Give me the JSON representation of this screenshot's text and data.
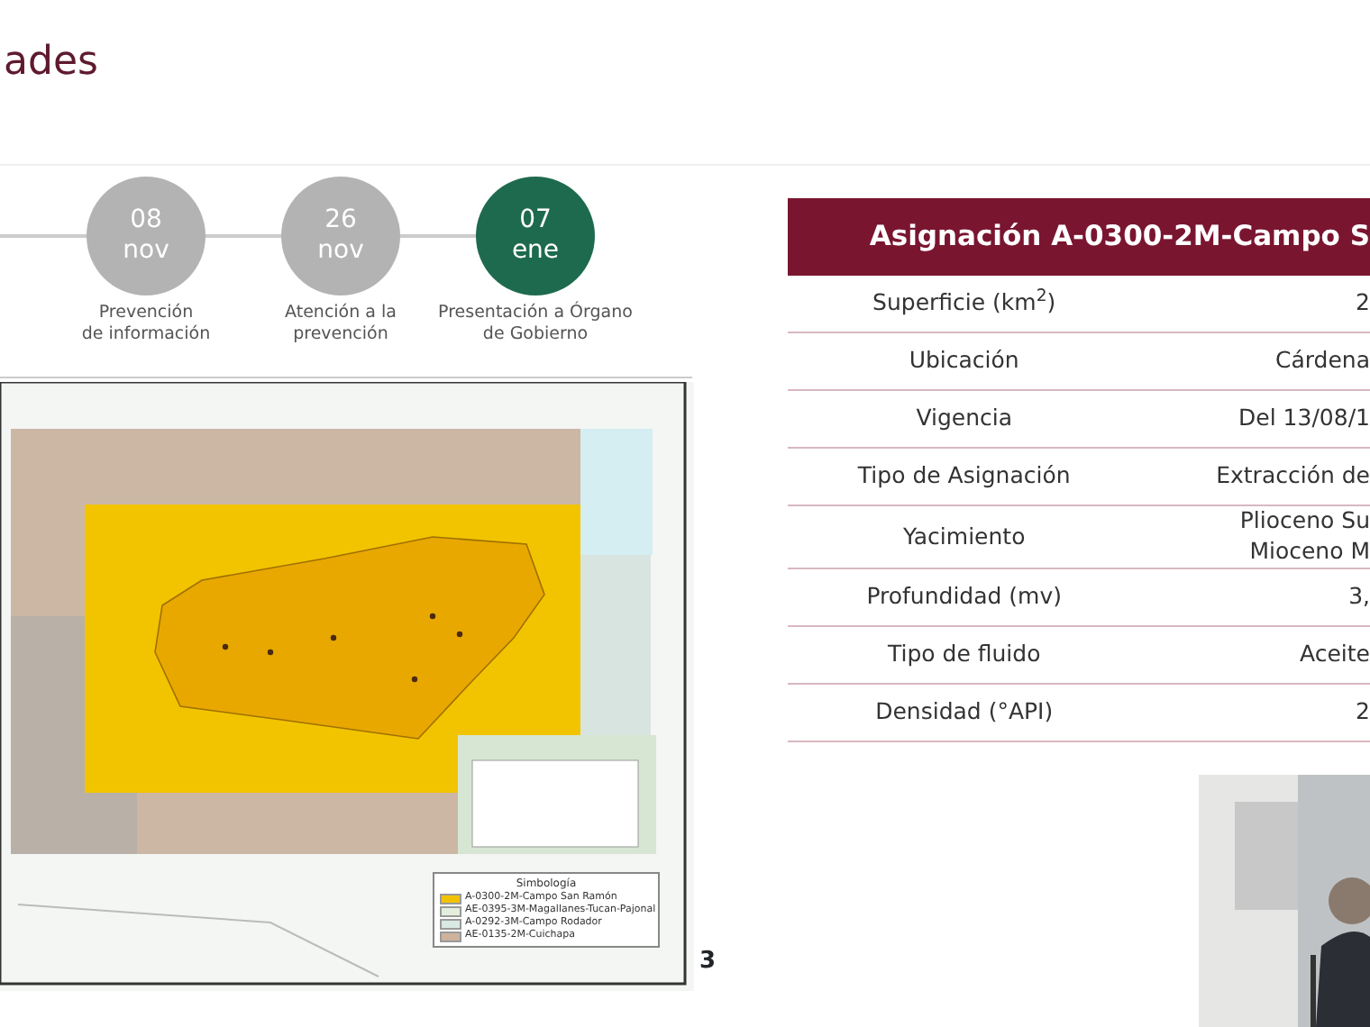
{
  "slide": {
    "title": "ades",
    "timeline": [
      {
        "day": "08",
        "month": "nov",
        "label": "Prevención\nde información",
        "selected": false
      },
      {
        "day": "26",
        "month": "nov",
        "label": "Atención a la\nprevención",
        "selected": false
      },
      {
        "day": "07",
        "month": "ene",
        "label": "Presentación a Órgano\nde Gobierno",
        "selected": true
      }
    ],
    "map": {
      "legend": {
        "title": "Simbología",
        "items": [
          {
            "label": "A-0300-2M-Campo San Ramón",
            "color": "#f2c200"
          },
          {
            "label": "AE-0395-3M-Magallanes-Tucan-Pajonal",
            "color": "#e4eedc"
          },
          {
            "label": "A-0292-3M-Campo Rodador",
            "color": "#d8e8e2"
          },
          {
            "label": "AE-0135-2M-Cuichapa",
            "color": "#cdb29e"
          }
        ]
      }
    },
    "page_number": "3",
    "table": {
      "title": "Asignación A-0300-2M-Campo S",
      "rows": [
        {
          "label": "Superficie (km$^{2}$)",
          "value": "2"
        },
        {
          "label": "Ubicación",
          "value": "Cárdena"
        },
        {
          "label": "Vigencia",
          "value": "Del 13/08/1"
        },
        {
          "label": "Tipo de Asignación",
          "value": "Extracción de"
        },
        {
          "label": "Yacimiento",
          "value": "Plioceno Su\nMioceno M"
        },
        {
          "label": "Profundidad (mv)",
          "value": "3,"
        },
        {
          "label": "Tipo de fluido",
          "value": "Aceite"
        },
        {
          "label": "Densidad (°API)",
          "value": "2"
        }
      ]
    }
  }
}
